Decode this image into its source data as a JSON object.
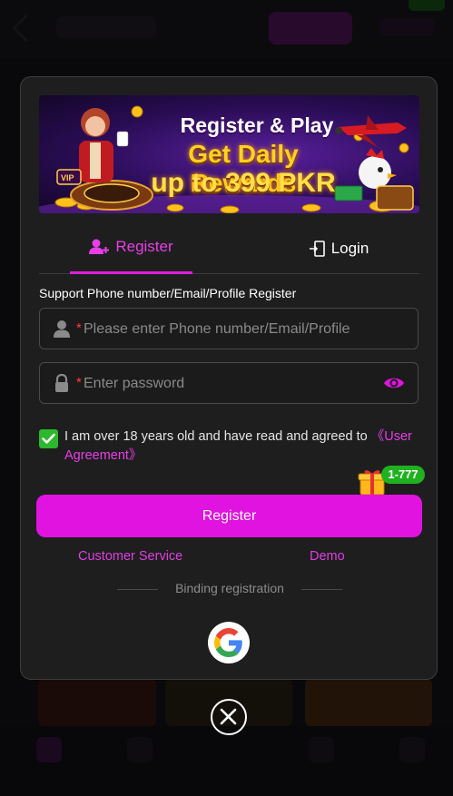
{
  "banner": {
    "line1": "Register & Play",
    "line2": "Get Daily Rewards",
    "line3": "up to 399 PKR"
  },
  "tabs": [
    {
      "label": "Register",
      "icon": "user-add-icon",
      "active": true
    },
    {
      "label": "Login",
      "icon": "login-door-icon",
      "active": false
    }
  ],
  "form": {
    "label": "Support Phone number/Email/Profile Register",
    "account_placeholder": "Please enter Phone number/Email/Profile",
    "password_placeholder": "Enter password",
    "required_mark": "*",
    "agree_text": "I am over 18 years old and have read and agreed to ",
    "agree_link": "《User Agreement》",
    "agree_checked": true
  },
  "promo_badge": "1-777",
  "register_button": "Register",
  "links": {
    "customer_service": "Customer Service",
    "demo": "Demo"
  },
  "binding_label": "Binding registration",
  "social": [
    {
      "icon": "google-icon"
    }
  ],
  "colors": {
    "accent": "#e013e0",
    "checkbox": "#2db82d",
    "modal_bg": "#1e1e1e",
    "badge": "#1fb11f"
  }
}
